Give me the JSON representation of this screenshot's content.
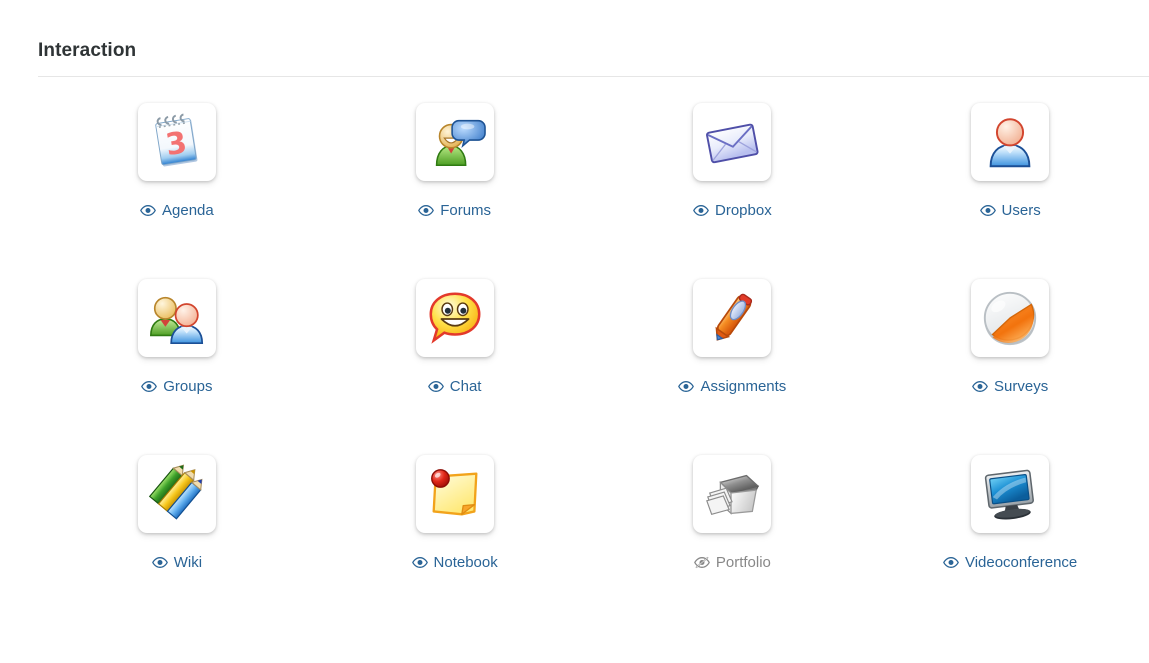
{
  "section": {
    "title": "Interaction"
  },
  "colors": {
    "link": "#2a6496",
    "hidden": "#888888",
    "title": "#2f3436",
    "divider": "#e6e6e6",
    "background": "#ffffff"
  },
  "tools": [
    {
      "label": "Agenda",
      "icon": "calendar-icon",
      "eye_icon": "eye-icon",
      "visible": true
    },
    {
      "label": "Forums",
      "icon": "user-speech-icon",
      "eye_icon": "eye-icon",
      "visible": true
    },
    {
      "label": "Dropbox",
      "icon": "envelope-icon",
      "eye_icon": "eye-icon",
      "visible": true
    },
    {
      "label": "Users",
      "icon": "user-icon",
      "eye_icon": "eye-icon",
      "visible": true
    },
    {
      "label": "Groups",
      "icon": "users-group-icon",
      "eye_icon": "eye-icon",
      "visible": true
    },
    {
      "label": "Chat",
      "icon": "smiley-bubble-icon",
      "eye_icon": "eye-icon",
      "visible": true
    },
    {
      "label": "Assignments",
      "icon": "pen-icon",
      "eye_icon": "eye-icon",
      "visible": true
    },
    {
      "label": "Surveys",
      "icon": "pie-chart-icon",
      "eye_icon": "eye-icon",
      "visible": true
    },
    {
      "label": "Wiki",
      "icon": "pencils-icon",
      "eye_icon": "eye-icon",
      "visible": true
    },
    {
      "label": "Notebook",
      "icon": "sticky-note-icon",
      "eye_icon": "eye-icon",
      "visible": true
    },
    {
      "label": "Portfolio",
      "icon": "portfolio-pages-icon",
      "eye_icon": "eye-slash-icon",
      "visible": false
    },
    {
      "label": "Videoconference",
      "icon": "monitor-icon",
      "eye_icon": "eye-icon",
      "visible": true
    }
  ]
}
